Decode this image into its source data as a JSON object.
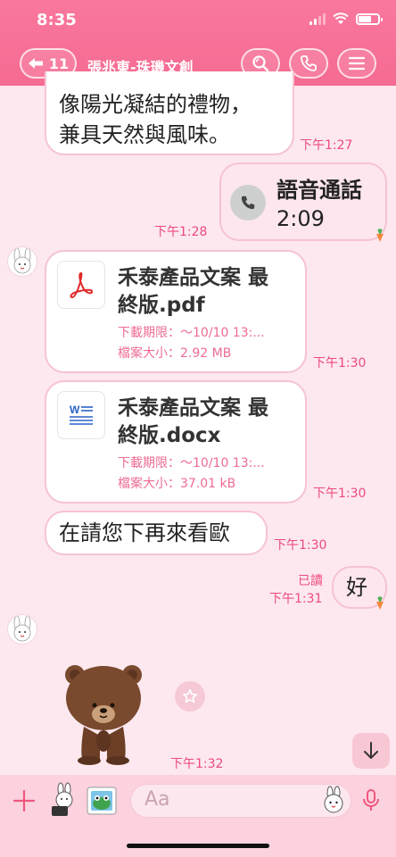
{
  "status": {
    "time": "8:35"
  },
  "header": {
    "back_count": "11",
    "title": "張兆東-珠璣文創",
    "search_icon": "search-icon",
    "call_icon": "phone-icon",
    "menu_icon": "menu-icon"
  },
  "messages": {
    "partial": {
      "line1": "像陽光凝結的禮物，",
      "line2": "兼具天然與風味。",
      "time": "下午1:27"
    },
    "voice_call": {
      "title": "語音通話",
      "duration": "2:09",
      "time": "下午1:28"
    },
    "file1": {
      "name_line1": "禾泰產品文案  最",
      "name_line2": "終版.pdf",
      "expiry": "下載期限：～10/10 13:...",
      "size": "檔案大小：2.92 MB",
      "time": "下午1:30"
    },
    "file2": {
      "name_line1": "禾泰產品文案  最",
      "name_line2": "終版.docx",
      "expiry": "下載期限：～10/10 13:...",
      "size": "檔案大小：37.01 kB",
      "time": "下午1:30"
    },
    "text1": {
      "text": "在請您下再來看歐",
      "time": "下午1:30"
    },
    "reply": {
      "text": "好",
      "read": "已讀",
      "time": "下午1:31"
    },
    "sticker": {
      "time": "下午1:32"
    }
  },
  "input": {
    "placeholder": "Aa"
  },
  "colors": {
    "brand": "#f56b92",
    "bubble_border": "#f6c3d2",
    "time_text": "#ee4b7e"
  }
}
